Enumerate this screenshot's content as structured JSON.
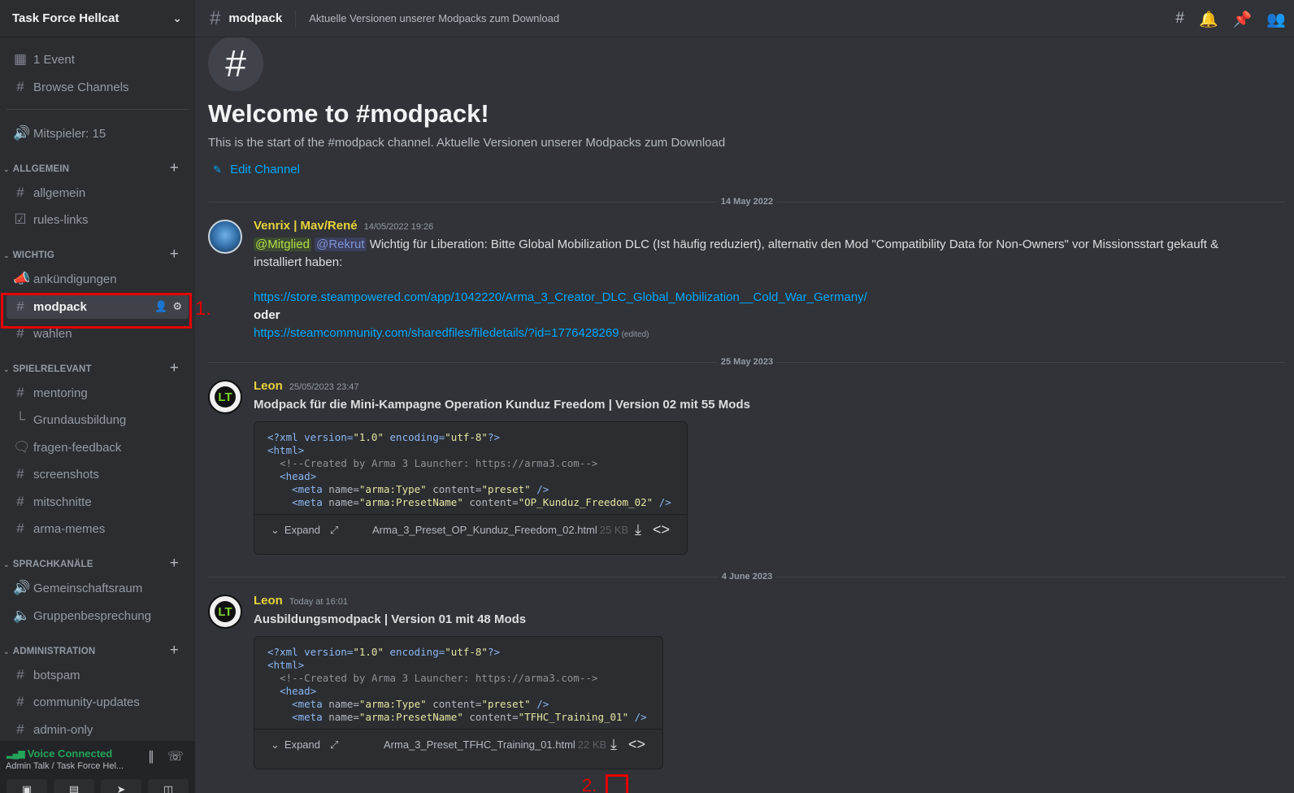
{
  "server": {
    "name": "Task Force Hellcat",
    "chevron_icon": "chevron-down-icon"
  },
  "sidebar": {
    "top_items": [
      {
        "label": "1 Event",
        "icon": "calendar-icon"
      },
      {
        "label": "Browse Channels",
        "icon": "browse-channels-icon"
      },
      {
        "label": "Mitspieler: 15",
        "icon": "voice-channel-icon"
      }
    ],
    "categories": [
      {
        "name": "ALLGEMEIN",
        "channels": [
          {
            "label": "allgemein",
            "icon": "hash-icon"
          },
          {
            "label": "rules-links",
            "icon": "checkbox-icon"
          }
        ]
      },
      {
        "name": "WICHTIG",
        "channels": [
          {
            "label": "ankündigungen",
            "icon": "announcement-icon"
          },
          {
            "label": "modpack",
            "icon": "hash-icon",
            "active": true
          },
          {
            "label": "wahlen",
            "icon": "hash-icon"
          }
        ]
      },
      {
        "name": "SPIELRELEVANT",
        "channels": [
          {
            "label": "mentoring",
            "icon": "hash-threads-icon"
          },
          {
            "label": "Grundausbildung",
            "icon": "thread-branch-icon"
          },
          {
            "label": "fragen-feedback",
            "icon": "forum-icon"
          },
          {
            "label": "screenshots",
            "icon": "hash-icon"
          },
          {
            "label": "mitschnitte",
            "icon": "hash-icon"
          },
          {
            "label": "arma-memes",
            "icon": "hash-icon"
          }
        ]
      },
      {
        "name": "SPRACHKANÄLE",
        "channels": [
          {
            "label": "Gemeinschaftsraum",
            "icon": "speaker-icon"
          },
          {
            "label": "Gruppenbesprechung",
            "icon": "speaker-locked-icon"
          }
        ]
      },
      {
        "name": "ADMINISTRATION",
        "channels": [
          {
            "label": "botspam",
            "icon": "hash-icon"
          },
          {
            "label": "community-updates",
            "icon": "hash-icon"
          },
          {
            "label": "admin-only",
            "icon": "hash-icon"
          }
        ]
      }
    ],
    "annotation_1": "1."
  },
  "voice_panel": {
    "status": "Voice Connected",
    "subtitle": "Admin Talk / Task Force Hel...",
    "icons": [
      "noise-suppression-icon",
      "disconnect-icon"
    ],
    "buttons": [
      "camera-icon",
      "screen-share-icon",
      "activity-icon",
      "soundboard-icon"
    ]
  },
  "header": {
    "channel_name": "modpack",
    "topic": "Aktuelle Versionen unserer Modpacks zum Download",
    "icons": [
      "threads-icon",
      "bell-icon",
      "pin-icon",
      "members-icon"
    ]
  },
  "welcome": {
    "title": "Welcome to #modpack!",
    "subtitle": "This is the start of the #modpack channel. Aktuelle Versionen unserer Modpacks zum Download",
    "edit_label": "Edit Channel"
  },
  "messages": [
    {
      "date": "14 May 2022",
      "author": "Venrix | Mav/René",
      "timestamp": "14/05/2022 19:26",
      "mention1": "@Mitglied",
      "mention2": "@Rekrut",
      "text1": "Wichtig für Liberation: Bitte Global Mobilization DLC (Ist häufig reduziert), alternativ den Mod \"Compatibility Data for Non-Owners\" vor Missionsstart gekauft &",
      "text2": "installiert haben:",
      "link1": "https://store.steampowered.com/app/1042220/Arma_3_Creator_DLC_Global_Mobilization__Cold_War_Germany/",
      "oder": "oder",
      "link2": "https://steamcommunity.com/sharedfiles/filedetails/?id=1776428269",
      "edited": "(edited)"
    },
    {
      "date": "25 May 2023",
      "author": "Leon",
      "timestamp": "25/05/2023 23:47",
      "title": "Modpack für die Mini-Kampagne Operation Kunduz Freedom | Version 02 mit 55 Mods",
      "preset_name": "OP_Kunduz_Freedom_02",
      "file_name": "Arma_3_Preset_OP_Kunduz_Freedom_02.html",
      "file_size": "25 KB",
      "expand": "Expand"
    },
    {
      "date": "4 June 2023",
      "author": "Leon",
      "timestamp": "Today at 16:01",
      "title": "Ausbildungsmodpack | Version 01 mit 48 Mods",
      "preset_name": "TFHC_Training_01",
      "file_name": "Arma_3_Preset_TFHC_Training_01.html",
      "file_size": "22 KB",
      "expand": "Expand",
      "annotation_2": "2."
    }
  ],
  "code": {
    "line1": "<?xml version=\"1.0\" encoding=\"utf-8\"?>",
    "line2": "<html>",
    "line3": "<!--Created by Arma 3 Launcher: https://arma3.com-->",
    "line4": "<head>"
  },
  "colors": {
    "accent_link": "#00a8fc",
    "author": "#e8d33b",
    "voice_green": "#23a55a",
    "annotation_red": "#e60000",
    "bg": "#313338",
    "sidebar": "#2b2d31"
  }
}
